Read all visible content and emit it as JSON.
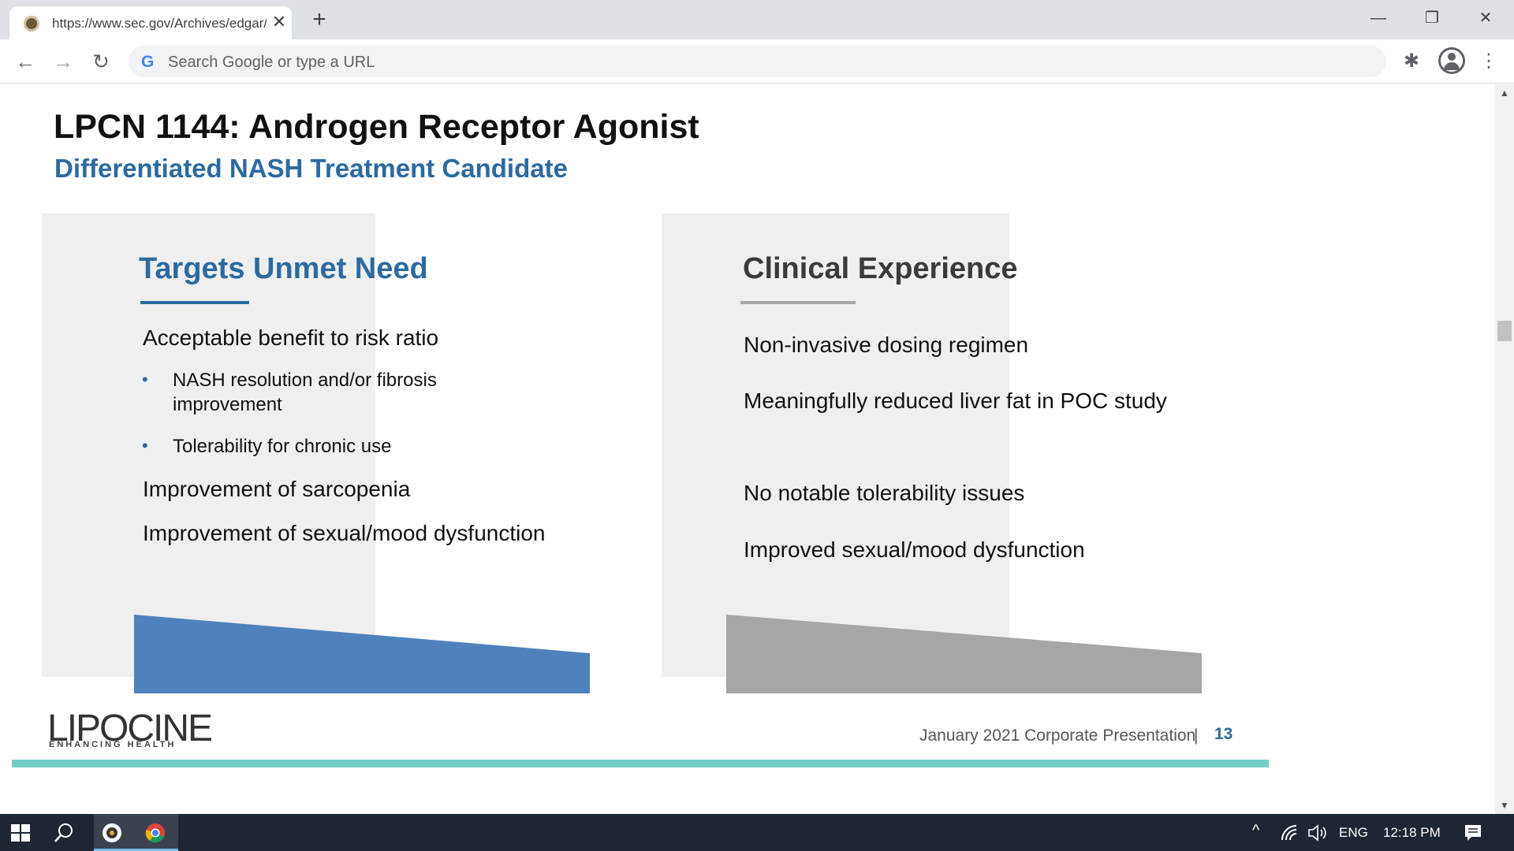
{
  "browser": {
    "tab_title": "https://www.sec.gov/Archives/edgar/data/",
    "tab_close": "✕",
    "new_tab": "+",
    "omnibox_placeholder": "Search Google or type a URL",
    "window_controls": {
      "minimize": "—",
      "restore": "❐",
      "close": "✕"
    },
    "nav": {
      "back": "←",
      "forward": "→",
      "reload": "↻"
    },
    "menu": "⋮",
    "extensions": "✱"
  },
  "slide": {
    "title": "LPCN 1144: Androgen Receptor Agonist",
    "subtitle": "Differentiated NASH Treatment Candidate",
    "left": {
      "heading": "Targets Unmet Need",
      "items": [
        "Acceptable benefit to risk ratio",
        "Improvement of sarcopenia",
        "Improvement of sexual/mood dysfunction"
      ],
      "bullets": [
        "NASH resolution and/or fibrosis improvement",
        "Tolerability for chronic use"
      ]
    },
    "right": {
      "heading": "Clinical Experience",
      "items": [
        "Non-invasive dosing regimen",
        "Meaningfully reduced liver fat in POC study",
        "No notable tolerability issues",
        "Improved sexual/mood dysfunction"
      ]
    },
    "footer": {
      "logo": "LIPOCINE",
      "logo_tagline": "ENHANCING HEALTH",
      "presentation": "January 2021 Corporate Presentation",
      "separator": "|",
      "page": "13"
    },
    "colors": {
      "accent_blue": "#2c6aa0",
      "left_shape": "#4f81bd",
      "right_shape": "#a6a6a6",
      "teal_bar": "#74d0c6"
    }
  },
  "taskbar": {
    "language": "ENG",
    "time": "12:18 PM"
  }
}
